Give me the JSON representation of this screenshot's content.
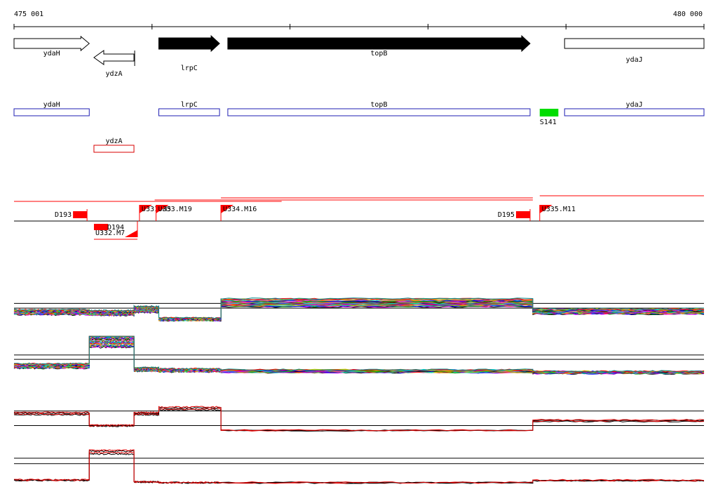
{
  "ruler": {
    "start_label": "475 001",
    "end_label": "480 000",
    "start": 475001,
    "end": 480000
  },
  "colors": {
    "gene_fill": "#000000",
    "gene_outline": "#000000",
    "cds_blue": "#1f1fb3",
    "cds_red": "#d80000",
    "marker_red": "#ff0000",
    "site_green": "#00dd00"
  },
  "genes": [
    {
      "name": "ydaH",
      "strand": "+",
      "start": 475001,
      "end": 475546,
      "filled": false
    },
    {
      "name": "ydzA",
      "strand": "-",
      "start": 475580,
      "end": 475870,
      "filled": false
    },
    {
      "name": "lrpC",
      "strand": "+",
      "start": 476050,
      "end": 476490,
      "filled": true
    },
    {
      "name": "topB",
      "strand": "+",
      "start": 476550,
      "end": 478740,
      "filled": true
    },
    {
      "name": "ydaJ",
      "strand": "+",
      "start": 478990,
      "end": 480000,
      "filled": false
    }
  ],
  "cds": [
    {
      "name": "ydaH",
      "start": 475001,
      "end": 475546,
      "color": "blue"
    },
    {
      "name": "lrpC",
      "start": 476050,
      "end": 476490,
      "color": "blue"
    },
    {
      "name": "topB",
      "start": 476550,
      "end": 478740,
      "color": "blue"
    },
    {
      "name": "ydaJ",
      "start": 478990,
      "end": 480000,
      "color": "blue"
    },
    {
      "name": "ydzA",
      "start": 475580,
      "end": 475870,
      "color": "red"
    }
  ],
  "sites": [
    {
      "name": "S141",
      "start": 478810,
      "end": 478945
    }
  ],
  "transcripts": [
    {
      "start": 475001,
      "end": 476940
    },
    {
      "start": 476020,
      "end": 478760
    },
    {
      "start": 476500,
      "end": 478760
    },
    {
      "start": 478810,
      "end": 480000
    }
  ],
  "upstream_markers": [
    {
      "name": "U331.M5",
      "pos": 475910
    },
    {
      "name": "U333.M19",
      "pos": 476030
    },
    {
      "name": "U334.M16",
      "pos": 476500
    },
    {
      "name": "U335.M11",
      "pos": 478810
    }
  ],
  "downstream_markers": [
    {
      "name": "D193",
      "pos": 475530
    },
    {
      "name": "D195",
      "pos": 478740
    }
  ],
  "below_markers": [
    {
      "name": "D194",
      "pos": 475580
    },
    {
      "name": "U332.M7",
      "pos": 475895
    }
  ],
  "profile_panels": [
    {
      "id": "panel-1",
      "colored": true,
      "levels": [
        0.38,
        0.36,
        0.45,
        0.2,
        0.62,
        0.4
      ]
    },
    {
      "id": "panel-2",
      "colored": true,
      "levels": [
        0.3,
        0.88,
        0.22,
        0.2,
        0.18,
        0.15
      ]
    },
    {
      "id": "panel-3",
      "colored": false,
      "levels": [
        0.62,
        0.25,
        0.62,
        0.78,
        0.1,
        0.4
      ]
    },
    {
      "id": "panel-4",
      "colored": false,
      "levels": [
        0.15,
        0.92,
        0.1,
        0.08,
        0.08,
        0.14
      ]
    }
  ]
}
